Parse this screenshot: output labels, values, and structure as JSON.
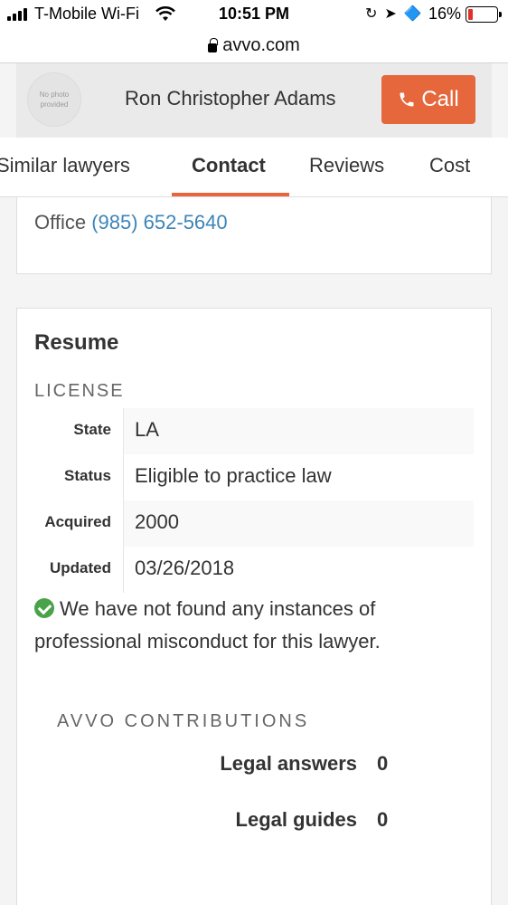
{
  "status_bar": {
    "carrier": "T-Mobile Wi-Fi",
    "time": "10:51 PM",
    "battery_percent": "16%",
    "battery_level": 0.16,
    "icons": [
      "orientation-lock-icon",
      "location-arrow-icon",
      "bluetooth-icon"
    ]
  },
  "browser": {
    "url": "avvo.com"
  },
  "lawyer": {
    "photo_placeholder_line1": "No photo",
    "photo_placeholder_line2": "provided",
    "name": "Ron Christopher Adams",
    "call_label": "Call"
  },
  "tabs": [
    {
      "label": "Similar lawyers",
      "active": false
    },
    {
      "label": "Contact",
      "active": true
    },
    {
      "label": "Reviews",
      "active": false
    },
    {
      "label": "Cost",
      "active": false
    }
  ],
  "office": {
    "label": "Office",
    "phone": "(985) 652-5640"
  },
  "resume": {
    "title": "Resume",
    "license_heading": "LICENSE",
    "license_rows": [
      {
        "key": "State",
        "value": "LA"
      },
      {
        "key": "Status",
        "value": "Eligible to practice law"
      },
      {
        "key": "Acquired",
        "value": "2000"
      },
      {
        "key": "Updated",
        "value": "03/26/2018"
      }
    ],
    "misconduct_text": "We have not found any instances of professional misconduct for this lawyer."
  },
  "contributions": {
    "heading": "AVVO CONTRIBUTIONS",
    "items": [
      {
        "label": "Legal answers",
        "value": "0"
      },
      {
        "label": "Legal guides",
        "value": "0"
      }
    ]
  },
  "colors": {
    "accent": "#e5673b",
    "link": "#3d84b8",
    "check": "#4aa24a",
    "battery_low": "#e0302a"
  }
}
